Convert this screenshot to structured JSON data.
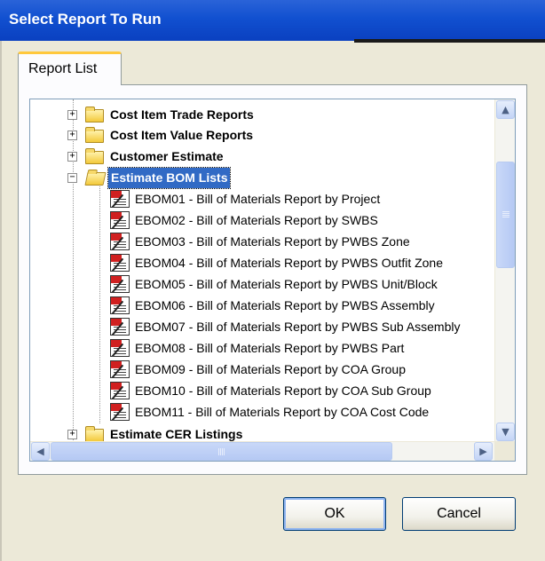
{
  "window": {
    "title": "Select Report To Run"
  },
  "tabs": [
    {
      "label": "Report List",
      "active": true
    }
  ],
  "tree": {
    "categories": [
      {
        "label": "Cost Item Trade Reports",
        "expanded": false
      },
      {
        "label": "Cost Item Value Reports",
        "expanded": false
      },
      {
        "label": "Customer Estimate",
        "expanded": false
      },
      {
        "label": "Estimate BOM Lists",
        "expanded": true,
        "selected": true
      },
      {
        "label": "Estimate CER Listings",
        "expanded": false
      }
    ],
    "reports": [
      "EBOM01 - Bill of Materials Report by Project",
      "EBOM02 - Bill of Materials Report by SWBS",
      "EBOM03 - Bill of Materials Report by PWBS Zone",
      "EBOM04 - Bill of Materials Report by PWBS Outfit Zone",
      "EBOM05 - Bill of Materials Report by PWBS Unit/Block",
      "EBOM06 - Bill of Materials Report by PWBS Assembly",
      "EBOM07 - Bill of Materials Report by PWBS Sub Assembly",
      "EBOM08 - Bill of Materials Report by PWBS Part",
      "EBOM09 - Bill of Materials Report by COA Group",
      "EBOM10 - Bill of Materials Report by COA Sub Group",
      "EBOM11 - Bill of Materials Report by COA Cost Code"
    ],
    "expander_collapsed": "+",
    "expander_expanded": "−"
  },
  "scrollbars": {
    "up": "▲",
    "down": "▼",
    "left": "◀",
    "right": "▶"
  },
  "buttons": {
    "ok": "OK",
    "cancel": "Cancel"
  },
  "colors": {
    "titlebar": "#0a40c0",
    "selection": "#316ac5",
    "tab_accent": "#ffc83c",
    "dialog_bg": "#ece9d8"
  }
}
